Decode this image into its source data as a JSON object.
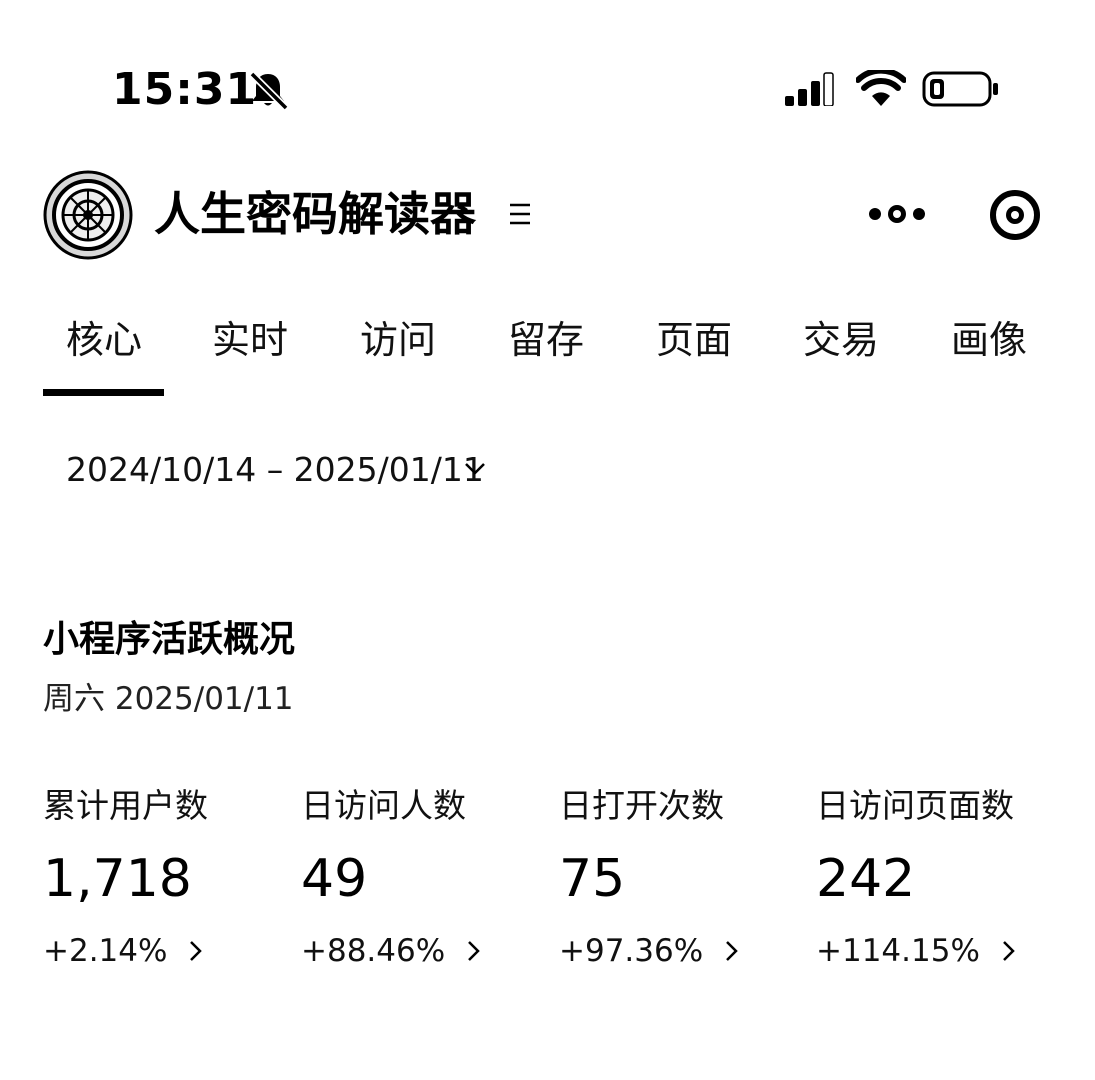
{
  "status_bar": {
    "time": "15:31",
    "icons": [
      "bell-off-icon",
      "signal-icon",
      "wifi-icon",
      "battery-icon"
    ]
  },
  "header": {
    "title": "人生密码解读器",
    "menu_glyph": "≡",
    "icons": [
      "app-logo",
      "more-icon",
      "close-icon"
    ]
  },
  "tabs": [
    {
      "label": "核心",
      "active": true
    },
    {
      "label": "实时",
      "active": false
    },
    {
      "label": "访问",
      "active": false
    },
    {
      "label": "留存",
      "active": false
    },
    {
      "label": "页面",
      "active": false
    },
    {
      "label": "交易",
      "active": false
    },
    {
      "label": "画像",
      "active": false
    }
  ],
  "date_range": {
    "value": "2024/10/14 – 2025/01/11"
  },
  "overview": {
    "title": "小程序活跃概况",
    "date": "周六 2025/01/11",
    "metrics": [
      {
        "label": "累计用户数",
        "value": "1,718",
        "change": "+2.14%"
      },
      {
        "label": "日访问人数",
        "value": "49",
        "change": "+88.46%"
      },
      {
        "label": "日打开次数",
        "value": "75",
        "change": "+97.36%"
      },
      {
        "label": "日访问页面数",
        "value": "242",
        "change": "+114.15%"
      }
    ]
  },
  "colors": {
    "text": "#000000",
    "background": "#ffffff",
    "tab_indicator": "#000000"
  }
}
